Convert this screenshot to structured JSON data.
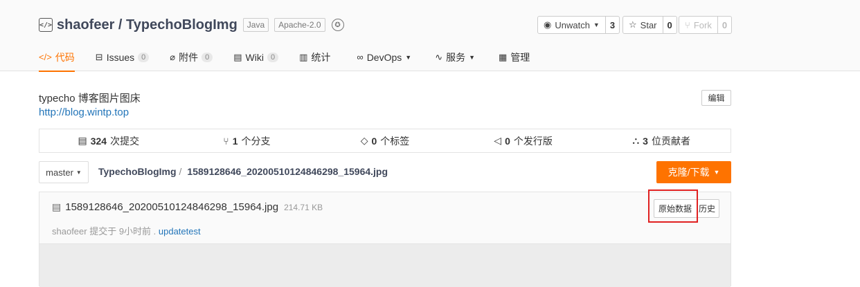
{
  "repo": {
    "owner": "shaofeer",
    "separator": " / ",
    "name": "TypechoBlogImg",
    "language": "Java",
    "license": "Apache-2.0"
  },
  "actions": {
    "watch_label": "Unwatch",
    "watch_count": "3",
    "star_label": "Star",
    "star_count": "0",
    "fork_label": "Fork",
    "fork_count": "0"
  },
  "tabs": [
    {
      "label": "代码",
      "icon": "code-icon",
      "count": null
    },
    {
      "label": "Issues",
      "icon": "issues-icon",
      "count": "0"
    },
    {
      "label": "附件",
      "icon": "paperclip-icon",
      "count": "0"
    },
    {
      "label": "Wiki",
      "icon": "wiki-icon",
      "count": "0"
    },
    {
      "label": "统计",
      "icon": "chart-icon",
      "count": null
    },
    {
      "label": "DevOps",
      "icon": "infinity-icon",
      "count": null
    },
    {
      "label": "服务",
      "icon": "pulse-icon",
      "count": null
    },
    {
      "label": "管理",
      "icon": "settings-icon",
      "count": null
    }
  ],
  "description": "typecho 博客图片图床",
  "homepage": "http://blog.wintp.top",
  "edit_label": "编辑",
  "stats": {
    "commits_count": "324",
    "commits_label": "次提交",
    "branches_count": "1",
    "branches_label": "个分支",
    "tags_count": "0",
    "tags_label": "个标签",
    "releases_count": "0",
    "releases_label": "个发行版",
    "contributors_count": "3",
    "contributors_label": "位贡献者"
  },
  "branch": "master",
  "breadcrumb": {
    "root": "TypechoBlogImg",
    "sep": "/",
    "file": "1589128646_20200510124846298_15964.jpg"
  },
  "clone_label": "克隆/下载",
  "file": {
    "name": "1589128646_20200510124846298_15964.jpg",
    "size": "214.71 KB",
    "commit_prefix": "shaofeer 提交于 9小时前 . ",
    "commit_message": "updatetest",
    "raw_label": "原始数据",
    "history_label": "历史"
  },
  "colors": {
    "accent": "#fe7300",
    "link": "#2375b9",
    "highlight": "#e02020"
  }
}
